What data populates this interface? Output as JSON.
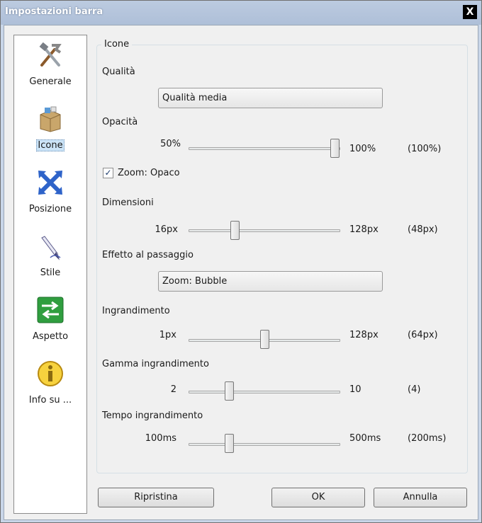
{
  "window": {
    "title": "Impostazioni barra",
    "close_glyph": "X"
  },
  "sidebar": {
    "items": [
      {
        "label": "Generale",
        "icon": "tools-icon",
        "selected": false
      },
      {
        "label": "Icone",
        "icon": "package-icon",
        "selected": true
      },
      {
        "label": "Posizione",
        "icon": "arrows-icon",
        "selected": false
      },
      {
        "label": "Stile",
        "icon": "pen-icon",
        "selected": false
      },
      {
        "label": "Aspetto",
        "icon": "swap-icon",
        "selected": false
      },
      {
        "label": "Info su ...",
        "icon": "info-icon",
        "selected": false
      }
    ]
  },
  "group": {
    "title": "Icone"
  },
  "quality": {
    "label": "Qualità",
    "value": "Qualità media"
  },
  "opacity": {
    "label": "Opacità",
    "min": "50%",
    "max": "100%",
    "current": "(100%)",
    "fraction": 1.0
  },
  "zoom_opaque": {
    "label": "Zoom: Opaco",
    "checked": true
  },
  "size": {
    "label": "Dimensioni",
    "min": "16px",
    "max": "128px",
    "current": "(48px)",
    "fraction": 0.29
  },
  "hover_effect": {
    "label": "Effetto al passaggio",
    "value": "Zoom: Bubble"
  },
  "zoom": {
    "label": "Ingrandimento",
    "min": "1px",
    "max": "128px",
    "current": "(64px)",
    "fraction": 0.5
  },
  "zoom_range": {
    "label": "Gamma ingrandimento",
    "min": "2",
    "max": "10",
    "current": "(4)",
    "fraction": 0.25
  },
  "zoom_time": {
    "label": "Tempo ingrandimento",
    "min": "100ms",
    "max": "500ms",
    "current": "(200ms)",
    "fraction": 0.25
  },
  "buttons": {
    "reset": "Ripristina",
    "ok": "OK",
    "cancel": "Annulla"
  }
}
